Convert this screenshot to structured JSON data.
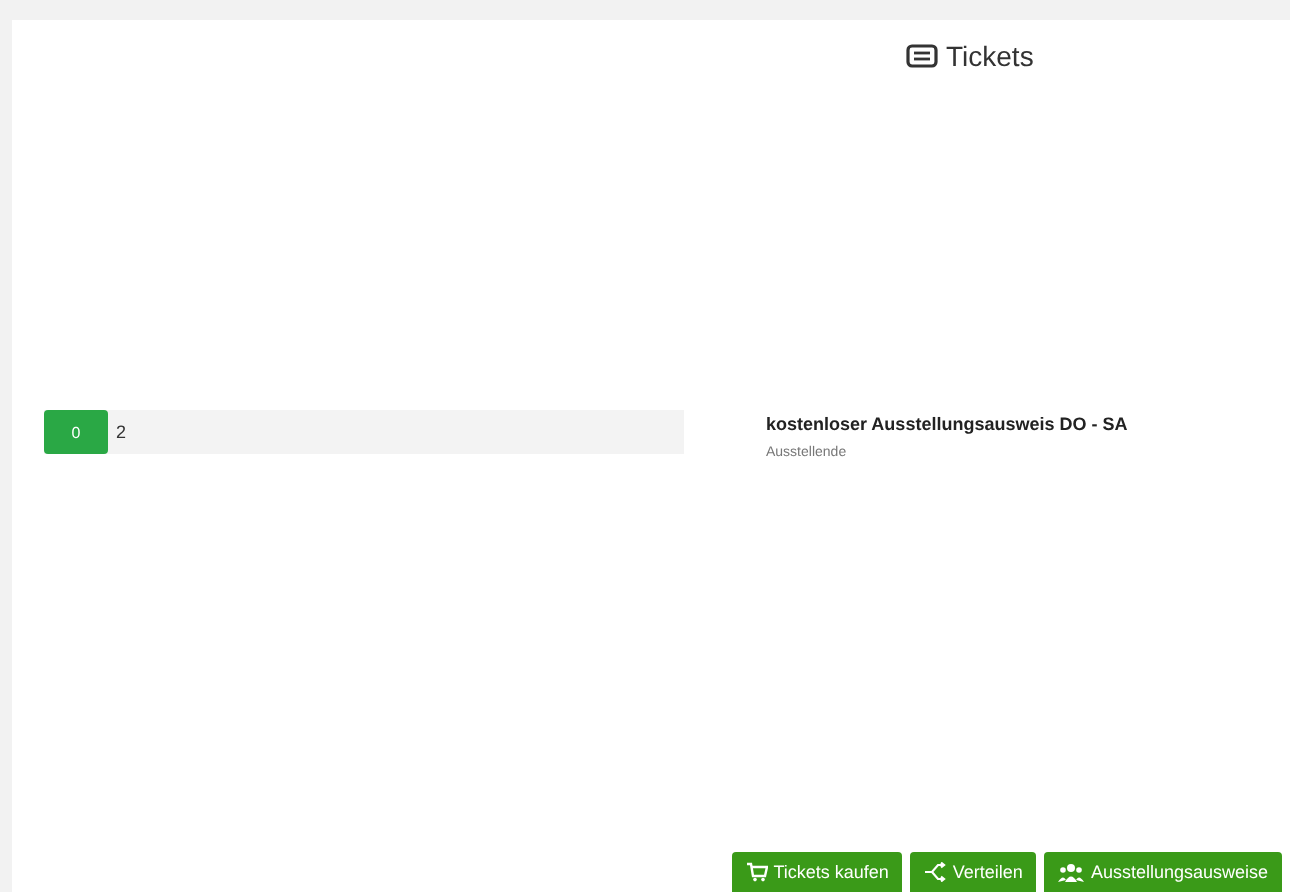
{
  "header": {
    "title": "Tickets"
  },
  "ticket": {
    "used": "0",
    "available": "2",
    "name": "kostenloser Ausstellungsausweis DO - SA",
    "category": "Ausstellende"
  },
  "buttons": [
    {
      "label": "Tickets kaufen",
      "kind": "cart"
    },
    {
      "label": "Verteilen",
      "kind": "share"
    },
    {
      "label": "Ausstellungsausweise",
      "kind": "badge"
    }
  ]
}
